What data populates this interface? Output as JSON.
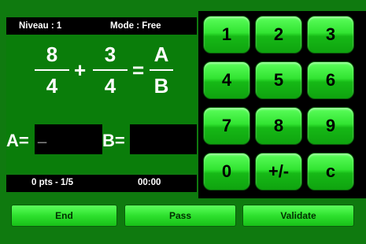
{
  "header": {
    "level": "Niveau : 1",
    "mode": "Mode : Free"
  },
  "equation": {
    "fraction1": {
      "numerator": "8",
      "denominator": "4"
    },
    "operator": "+",
    "fraction2": {
      "numerator": "3",
      "denominator": "4"
    },
    "equals": "=",
    "result": {
      "numerator": "A",
      "denominator": "B"
    }
  },
  "answer": {
    "a_label": "A=",
    "a_value": "_",
    "b_label": "B=",
    "b_value": ""
  },
  "status": {
    "score": "0 pts - 1/5",
    "timer": "00:00"
  },
  "keypad": {
    "keys": [
      "1",
      "2",
      "3",
      "4",
      "5",
      "6",
      "7",
      "8",
      "9",
      "0",
      "+/-",
      "c"
    ]
  },
  "actions": {
    "end": "End",
    "pass": "Pass",
    "validate": "Validate"
  },
  "colors": {
    "background": "#0f7a0f",
    "key": "#31e431",
    "panel": "#000000"
  }
}
